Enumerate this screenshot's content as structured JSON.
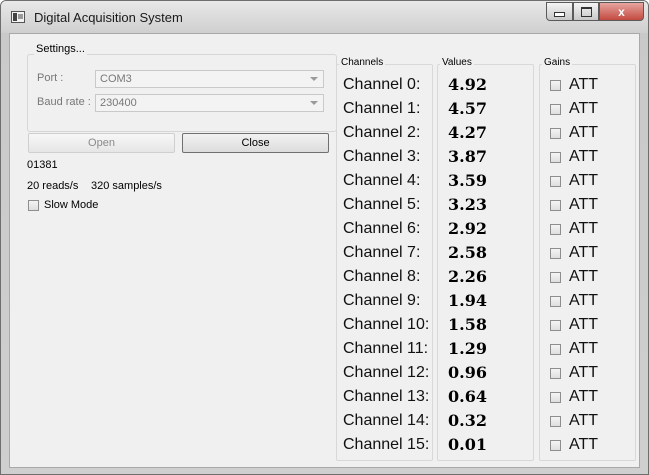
{
  "window": {
    "title": "Digital Acquisition System",
    "controls": {
      "close_glyph": "x"
    }
  },
  "settings": {
    "title": "Settings...",
    "port_label": "Port :",
    "port_value": "COM3",
    "baud_label": "Baud rate :",
    "baud_value": "230400"
  },
  "buttons": {
    "open": "Open",
    "close": "Close"
  },
  "status": {
    "counter": "01381",
    "reads": "20 reads/s",
    "samples": "320 samples/s",
    "slow_mode_label": "Slow Mode",
    "slow_mode_checked": false
  },
  "columns": {
    "channels": "Channels",
    "values": "Values",
    "gains": "Gains"
  },
  "channels": [
    {
      "label": "Channel 0:",
      "value": "4.92",
      "gain": "ATT"
    },
    {
      "label": "Channel 1:",
      "value": "4.57",
      "gain": "ATT"
    },
    {
      "label": "Channel 2:",
      "value": "4.27",
      "gain": "ATT"
    },
    {
      "label": "Channel 3:",
      "value": "3.87",
      "gain": "ATT"
    },
    {
      "label": "Channel 4:",
      "value": "3.59",
      "gain": "ATT"
    },
    {
      "label": "Channel 5:",
      "value": "3.23",
      "gain": "ATT"
    },
    {
      "label": "Channel 6:",
      "value": "2.92",
      "gain": "ATT"
    },
    {
      "label": "Channel 7:",
      "value": "2.58",
      "gain": "ATT"
    },
    {
      "label": "Channel 8:",
      "value": "2.26",
      "gain": "ATT"
    },
    {
      "label": "Channel 9:",
      "value": "1.94",
      "gain": "ATT"
    },
    {
      "label": "Channel 10:",
      "value": "1.58",
      "gain": "ATT"
    },
    {
      "label": "Channel 11:",
      "value": "1.29",
      "gain": "ATT"
    },
    {
      "label": "Channel 12:",
      "value": "0.96",
      "gain": "ATT"
    },
    {
      "label": "Channel 13:",
      "value": "0.64",
      "gain": "ATT"
    },
    {
      "label": "Channel 14:",
      "value": "0.32",
      "gain": "ATT"
    },
    {
      "label": "Channel 15:",
      "value": "0.01",
      "gain": "ATT"
    }
  ]
}
